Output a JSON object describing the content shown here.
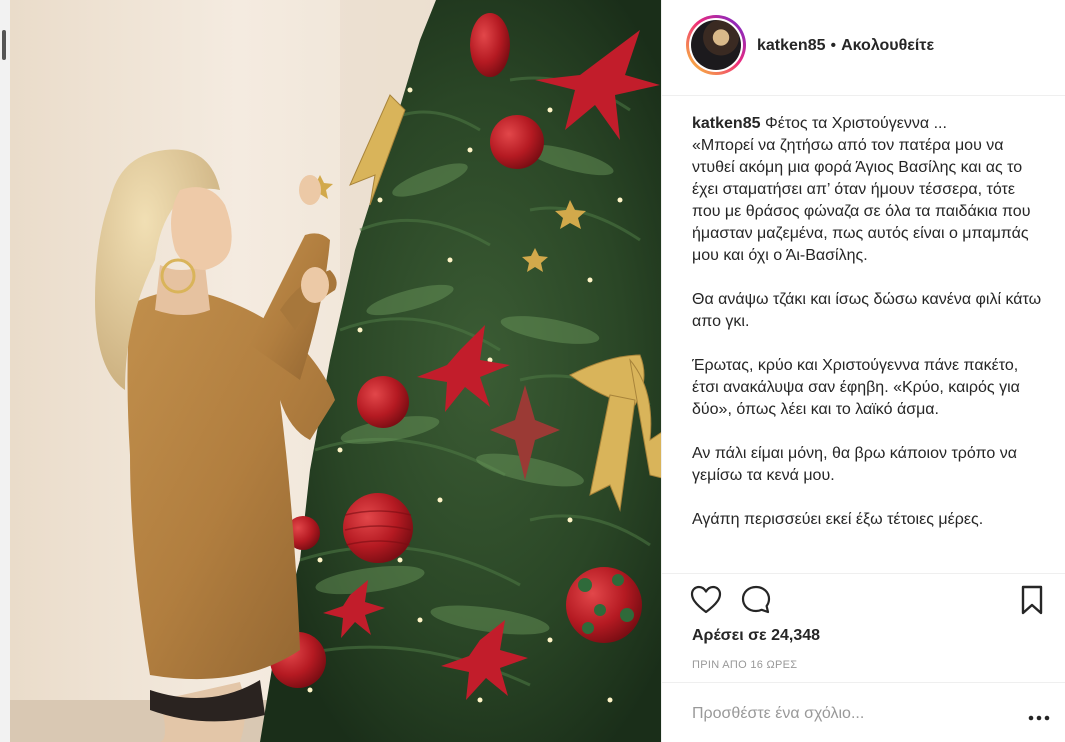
{
  "header": {
    "username": "katken85",
    "separator": "•",
    "follow_status": "Ακολουθείτε"
  },
  "caption": {
    "username": "katken85",
    "paragraphs": [
      "Φέτος τα Χριστούγεννα ...\n«Μπορεί να ζητήσω από τον πατέρα μου να ντυθεί ακόμη μια φορά Άγιος Βασίλης και ας το έχει σταματήσει απ’ όταν ήμουν τέσσερα, τότε που με θράσος φώναζα σε όλα τα παιδάκια που ήμασταν μαζεμένα, πως αυτός είναι ο μπαμπάς μου και όχι ο Άι-Βασίλης.",
      "Θα ανάψω τζάκι και ίσως δώσω κανένα φιλί κάτω απο γκι.",
      "Έρωτας, κρύο και Χριστούγεννα πάνε πακέτο, έτσι ανακάλυψα σαν έφηβη. «Κρύο, καιρός για δύο», όπως λέει και το λαϊκό άσμα.",
      "Αν πάλι είμαι μόνη, θα βρω κάποιον τρόπο να γεμίσω τα κενά μου.",
      "Αγάπη περισσεύει εκεί έξω τέτοιες μέρες."
    ]
  },
  "actions": {
    "like_icon": "heart-outline",
    "comment_icon": "speech-bubble",
    "save_icon": "bookmark"
  },
  "likes_text": "Αρέσει σε 24,348",
  "time_text": "ΠΡΙΝ ΑΠΟ 16 ΩΡΕΣ",
  "comment": {
    "placeholder": "Προσθέστε ένα σχόλιο...",
    "more_icon": "ellipsis"
  },
  "photo": {
    "description_icon": "christmas-tree-photo"
  }
}
